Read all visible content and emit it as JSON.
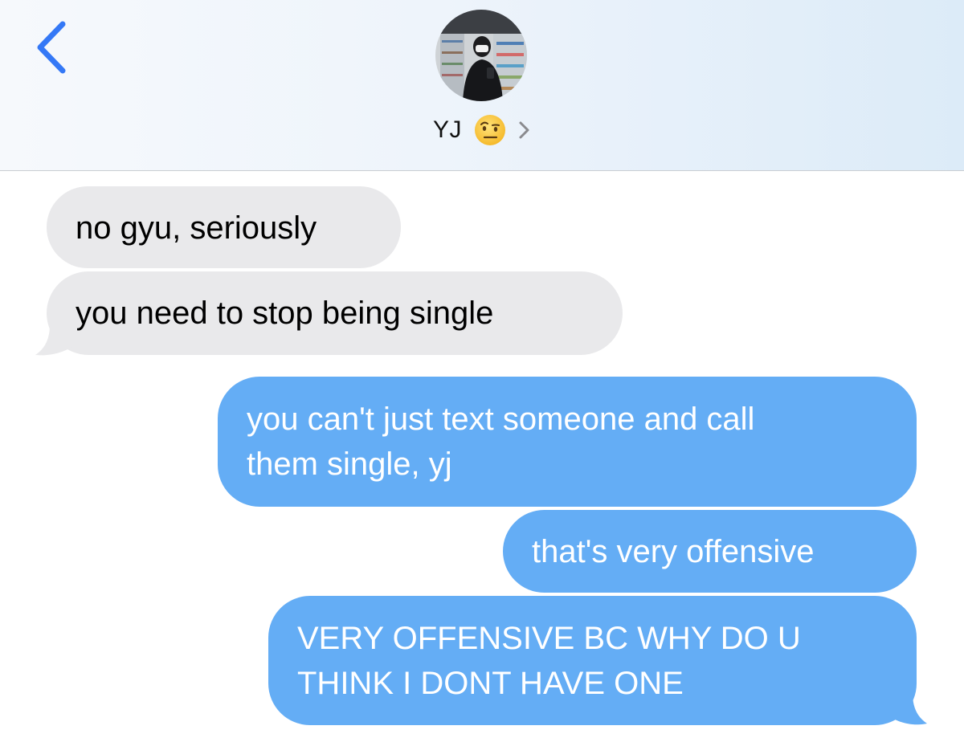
{
  "header": {
    "back_icon": "chevron-left-icon",
    "contact_name": "YJ",
    "contact_emoji": "face-with-raised-eyebrow",
    "details_icon": "chevron-right-icon",
    "accent_color": "#3478f6"
  },
  "messages": [
    {
      "direction": "incoming",
      "text": "no gyu, seriously"
    },
    {
      "direction": "incoming",
      "text": "you need to stop being single"
    },
    {
      "direction": "outgoing",
      "lines": [
        "you can't just text someone and call",
        "them single, yj"
      ]
    },
    {
      "direction": "outgoing",
      "text": "that's very offensive"
    },
    {
      "direction": "outgoing",
      "lines": [
        "VERY OFFENSIVE BC WHY DO U",
        "THINK I DONT HAVE ONE"
      ]
    }
  ],
  "colors": {
    "incoming_bubble": "#e9e9eb",
    "outgoing_bubble": "#64adf5",
    "outgoing_text": "#ffffff"
  }
}
